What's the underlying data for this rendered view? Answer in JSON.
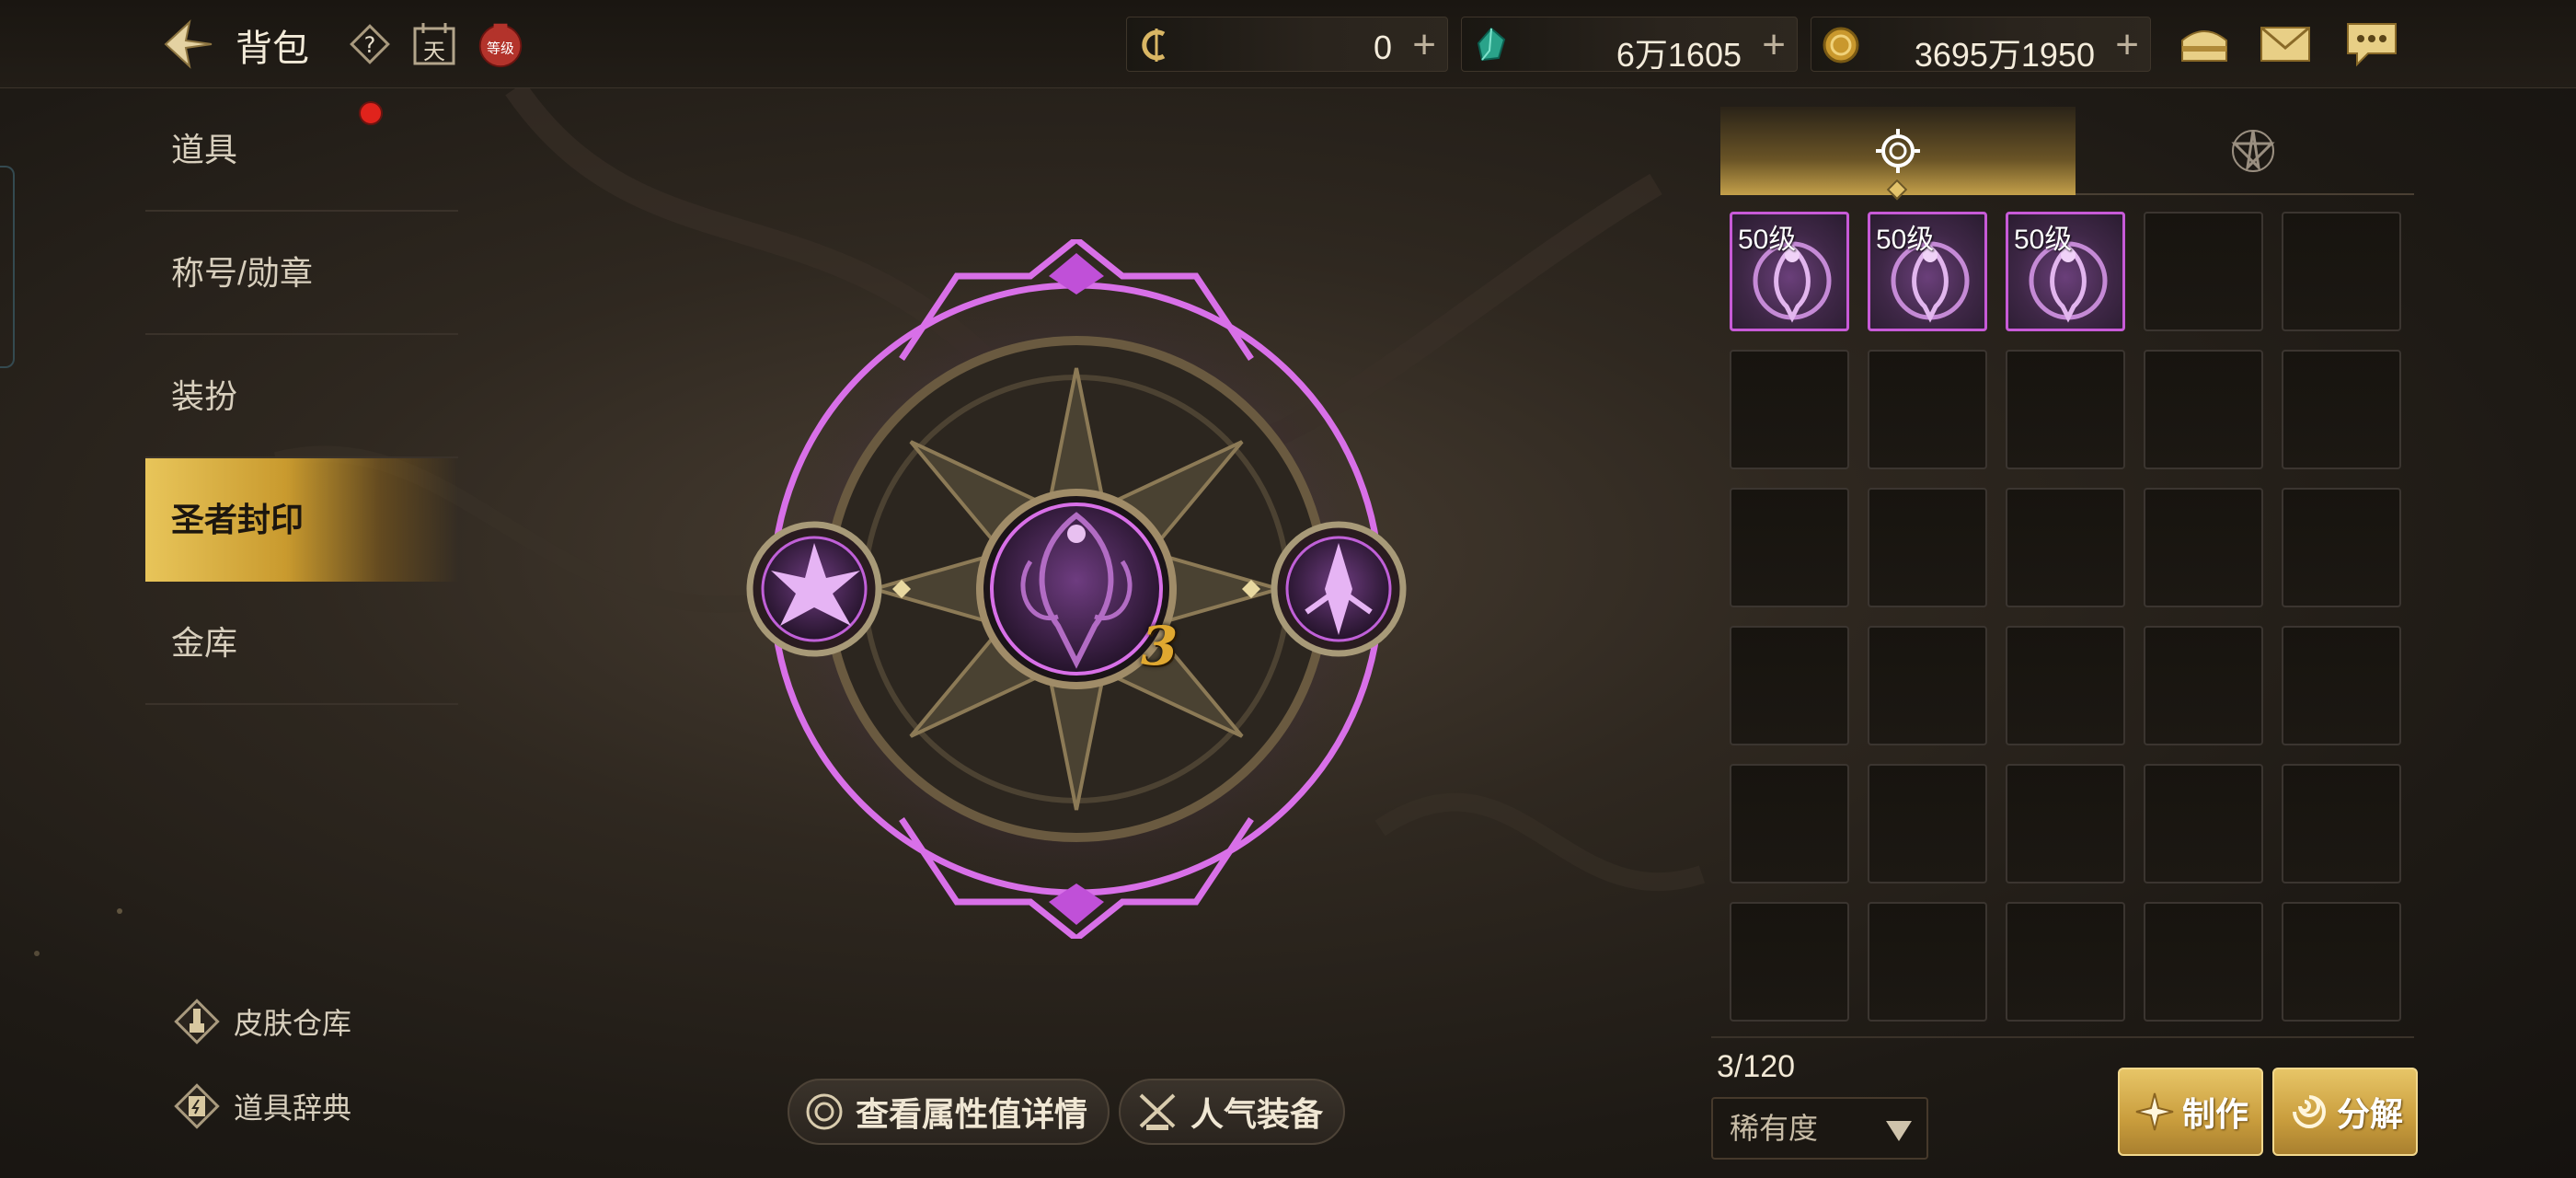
{
  "header": {
    "title": "背包",
    "title_icon": "back-arrow-icon",
    "badge_day": "天",
    "badge_level": "等级"
  },
  "currencies": [
    {
      "icon": "c-coin-icon",
      "value": "0"
    },
    {
      "icon": "crystal-icon",
      "value": "6万1605"
    },
    {
      "icon": "gold-coin-icon",
      "value": "3695万1950"
    }
  ],
  "sidebar": {
    "items": [
      {
        "label": "道具"
      },
      {
        "label": "称号/勋章"
      },
      {
        "label": "装扮"
      },
      {
        "label": "圣者封印"
      },
      {
        "label": "金库"
      }
    ],
    "active": "圣者封印",
    "footer": [
      {
        "label": "皮肤仓库"
      },
      {
        "label": "道具辞典"
      }
    ]
  },
  "seal": {
    "level": "3",
    "accent": "#d870e8"
  },
  "bottom_buttons": {
    "details": "查看属性值详情",
    "popular": "人气装备"
  },
  "inventory": {
    "slots_filled": [
      {
        "level": "50级"
      },
      {
        "level": "50级"
      },
      {
        "level": "50级"
      }
    ],
    "total_slots_visible": 30,
    "capacity": "3/120",
    "rarity_label": "稀有度"
  },
  "actions": {
    "craft": "制作",
    "decompose": "分解"
  },
  "colors": {
    "gold": "#d7b45a",
    "purple": "#c75ad7",
    "notification": "#e0231c"
  }
}
